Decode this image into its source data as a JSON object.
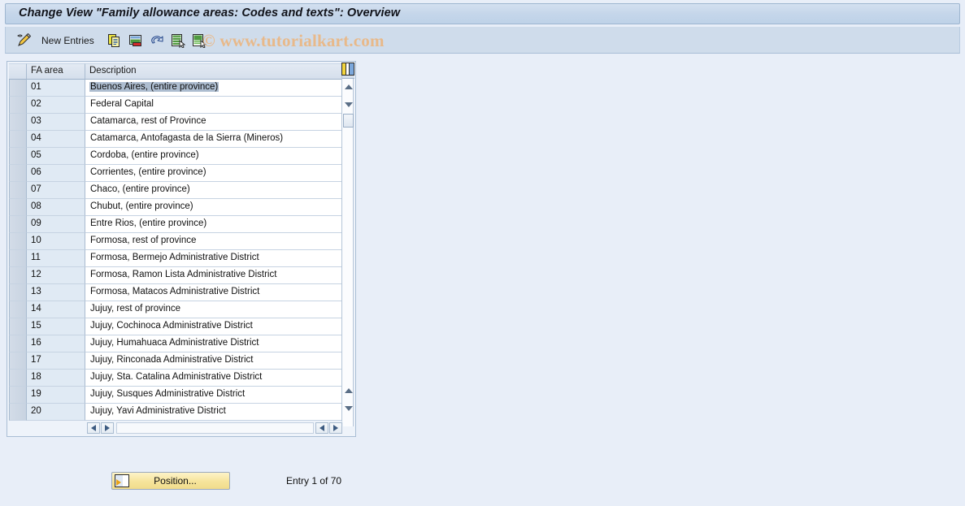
{
  "window": {
    "title": "Change View \"Family allowance areas: Codes and texts\": Overview"
  },
  "toolbar": {
    "display_change_icon": "pencil-icon",
    "new_entries_label": "New Entries",
    "buttons": [
      {
        "name": "copy-as-icon",
        "tooltip": "Copy As..."
      },
      {
        "name": "delete-icon",
        "tooltip": "Delete"
      },
      {
        "name": "undo-icon",
        "tooltip": "Undo Change"
      },
      {
        "name": "select-all-icon",
        "tooltip": "Select All"
      },
      {
        "name": "deselect-all-icon",
        "tooltip": "Deselect All"
      }
    ]
  },
  "watermark": {
    "text": "© www.tutorialkart.com",
    "color": "#e8b98a"
  },
  "table": {
    "config_icon": "table-settings-icon",
    "columns": [
      {
        "key": "select",
        "label": ""
      },
      {
        "key": "code",
        "label": "FA area"
      },
      {
        "key": "desc",
        "label": "Description"
      }
    ],
    "selected_row_index": 0,
    "rows": [
      {
        "code": "01",
        "desc": "Buenos Aires, (entire province)"
      },
      {
        "code": "02",
        "desc": "Federal Capital"
      },
      {
        "code": "03",
        "desc": "Catamarca, rest of Province"
      },
      {
        "code": "04",
        "desc": "Catamarca, Antofagasta de la Sierra (Mineros)"
      },
      {
        "code": "05",
        "desc": "Cordoba, (entire province)"
      },
      {
        "code": "06",
        "desc": "Corrientes, (entire province)"
      },
      {
        "code": "07",
        "desc": "Chaco, (entire province)"
      },
      {
        "code": "08",
        "desc": "Chubut, (entire province)"
      },
      {
        "code": "09",
        "desc": "Entre Rios, (entire province)"
      },
      {
        "code": "10",
        "desc": "Formosa, rest of province"
      },
      {
        "code": "11",
        "desc": "Formosa, Bermejo Administrative District"
      },
      {
        "code": "12",
        "desc": "Formosa, Ramon Lista Administrative District"
      },
      {
        "code": "13",
        "desc": "Formosa, Matacos Administrative District"
      },
      {
        "code": "14",
        "desc": "Jujuy, rest of province"
      },
      {
        "code": "15",
        "desc": "Jujuy, Cochinoca Administrative District"
      },
      {
        "code": "16",
        "desc": "Jujuy, Humahuaca Administrative District"
      },
      {
        "code": "17",
        "desc": "Jujuy, Rinconada Administrative District"
      },
      {
        "code": "18",
        "desc": "Jujuy, Sta. Catalina Administrative District"
      },
      {
        "code": "19",
        "desc": "Jujuy, Susques Administrative District"
      },
      {
        "code": "20",
        "desc": "Jujuy, Yavi Administrative District"
      }
    ]
  },
  "footer": {
    "position_button_label": "Position...",
    "entry_info": "Entry 1 of 70"
  }
}
